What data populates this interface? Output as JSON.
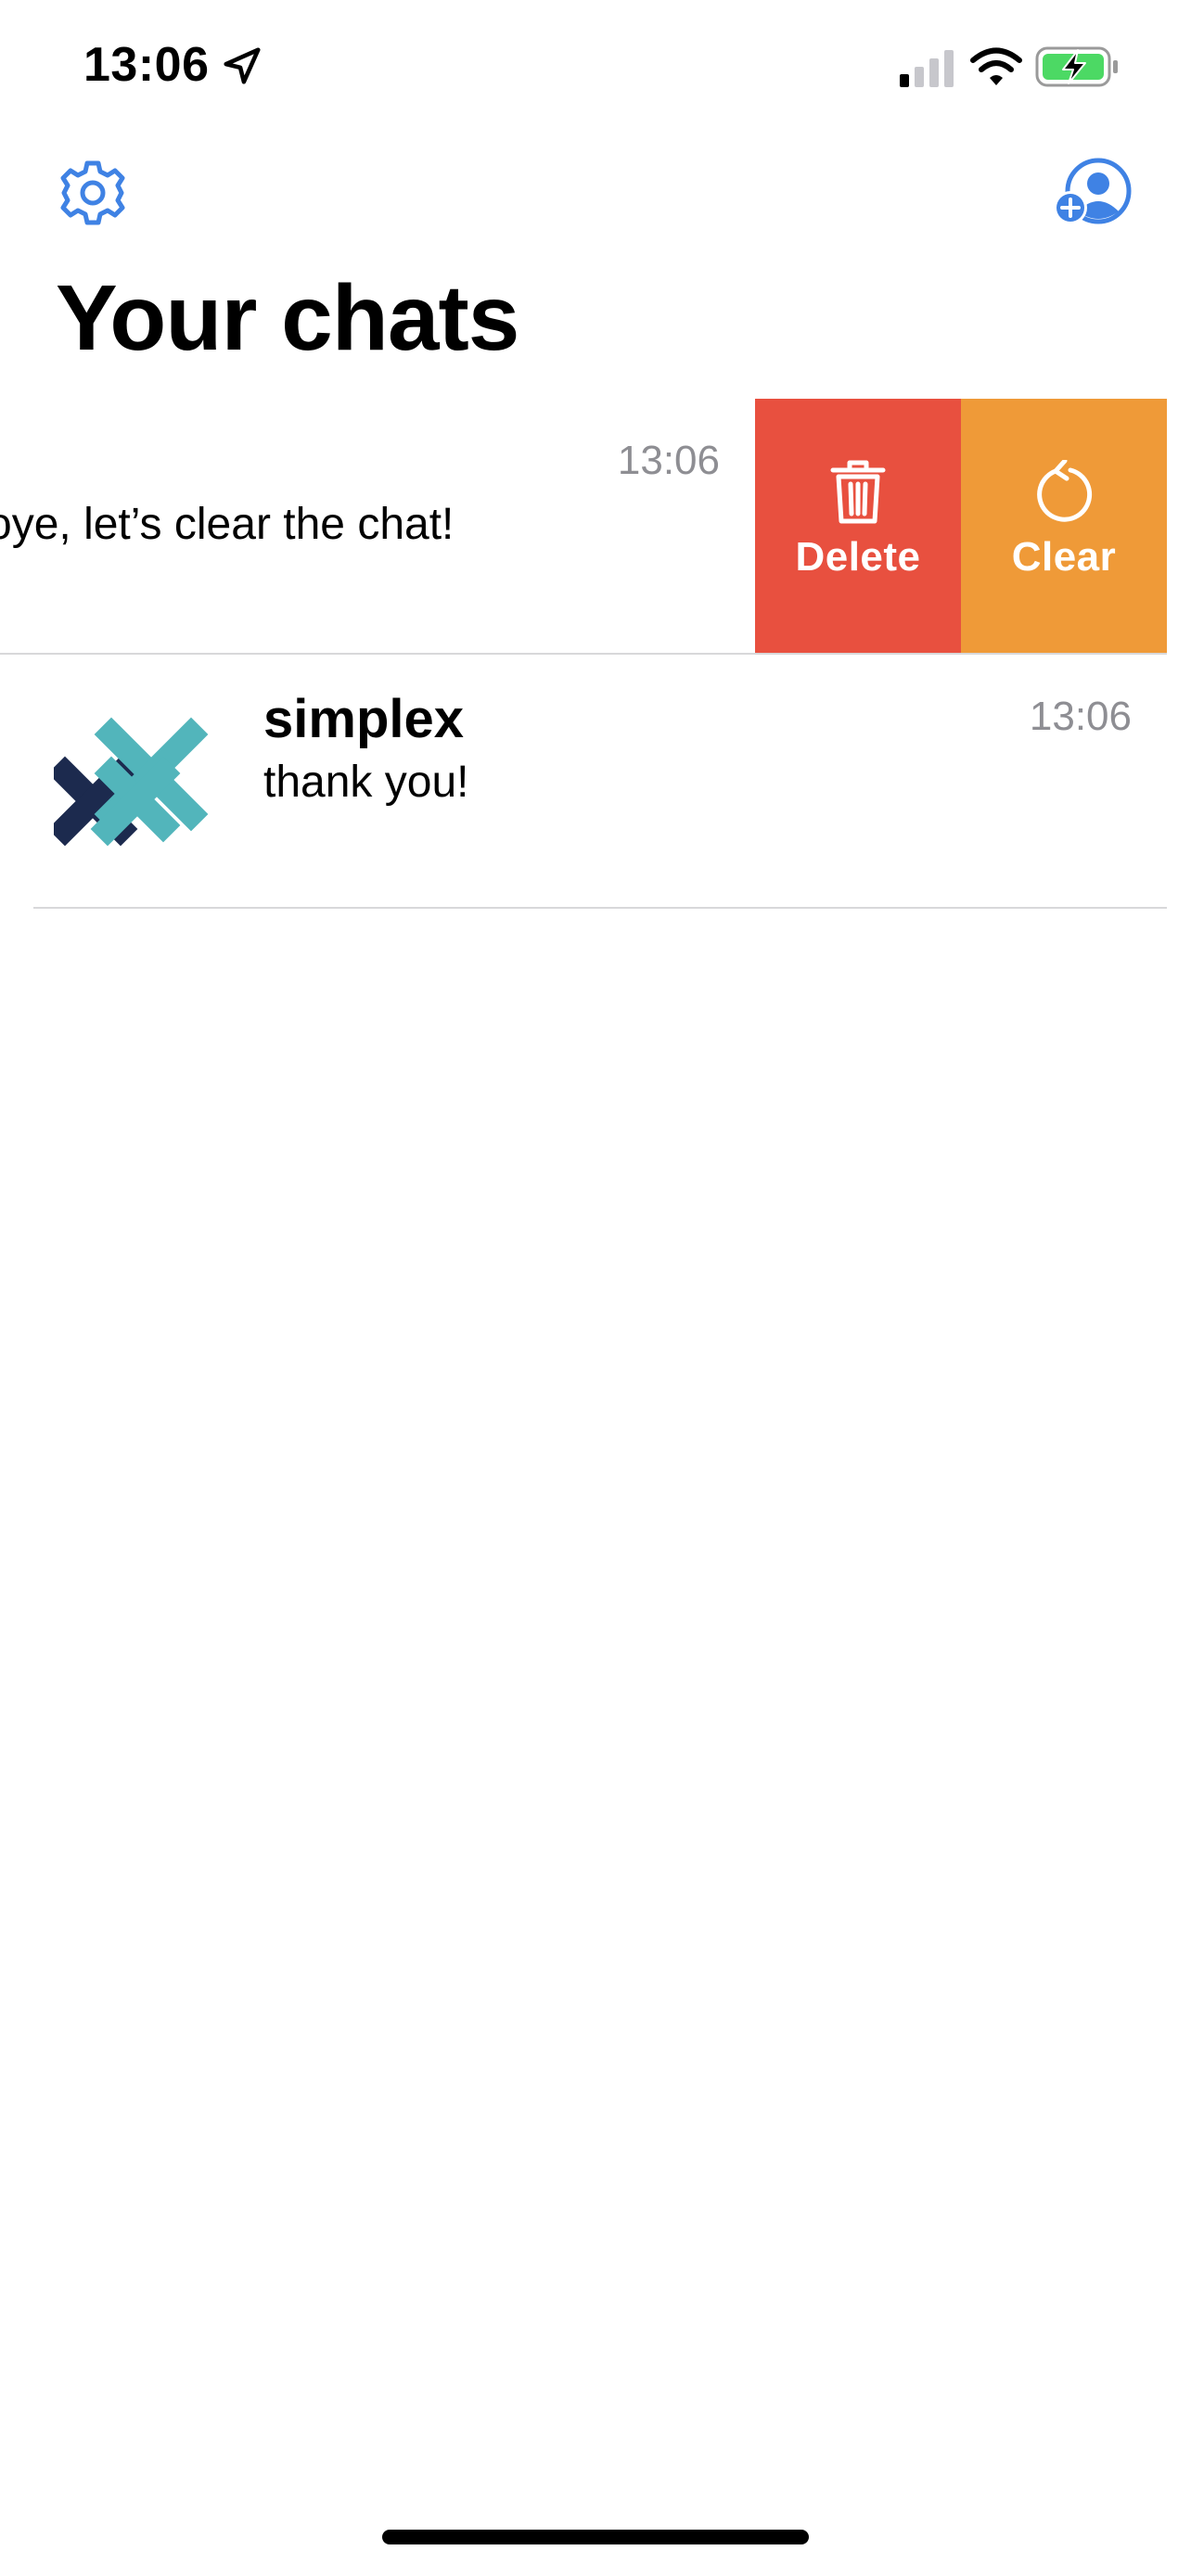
{
  "status_bar": {
    "time": "13:06"
  },
  "header": {
    "title": "Your chats",
    "settings_icon": "gear-icon",
    "add_contact_icon": "person-add-icon"
  },
  "chats": [
    {
      "preview": "oye, let’s clear the chat!",
      "time": "13:06",
      "swiped": true,
      "actions": [
        {
          "label": "Delete",
          "icon": "trash-icon",
          "color": "#e8503f"
        },
        {
          "label": "Clear",
          "icon": "rotate-icon",
          "color": "#ef9a38"
        }
      ]
    },
    {
      "name": "simplex",
      "preview": "thank you!",
      "time": "13:06",
      "avatar": "simplex-logo"
    }
  ],
  "colors": {
    "accent": "#3f82e4",
    "delete": "#e8503f",
    "clear": "#ef9a38",
    "timestamp": "#8e8e93",
    "logo_dark": "#1c2a4e",
    "logo_teal": "#52b5bb"
  }
}
